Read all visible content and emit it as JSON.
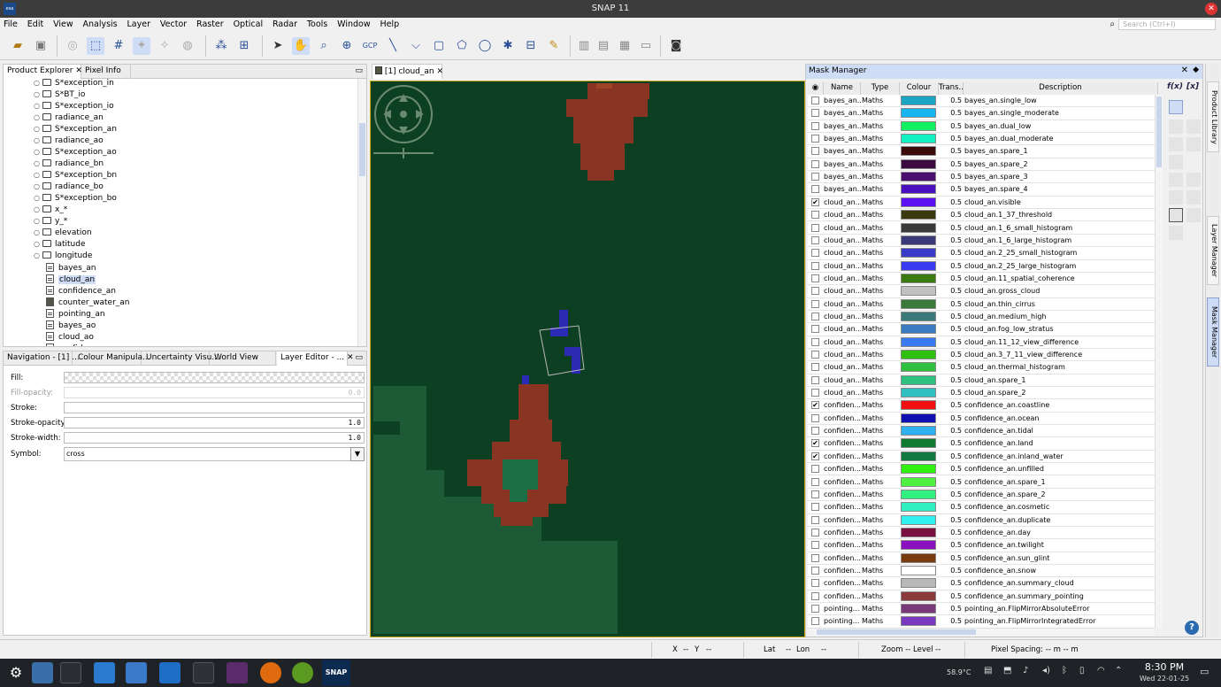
{
  "app": {
    "title": "SNAP 11",
    "logo_text": "esa SNAP"
  },
  "menu": [
    "File",
    "Edit",
    "View",
    "Analysis",
    "Layer",
    "Vector",
    "Raster",
    "Optical",
    "Radar",
    "Tools",
    "Window",
    "Help"
  ],
  "search": {
    "placeholder": "Search (Ctrl+I)"
  },
  "left_tabs": {
    "product_explorer": "Product Explorer",
    "pixel_info": "Pixel Info"
  },
  "tree": [
    {
      "label": "S*exception_in",
      "kind": "folder"
    },
    {
      "label": "S*BT_io",
      "kind": "folder"
    },
    {
      "label": "S*exception_io",
      "kind": "folder"
    },
    {
      "label": "radiance_an",
      "kind": "folder"
    },
    {
      "label": "S*exception_an",
      "kind": "folder"
    },
    {
      "label": "radiance_ao",
      "kind": "folder"
    },
    {
      "label": "S*exception_ao",
      "kind": "folder"
    },
    {
      "label": "radiance_bn",
      "kind": "folder"
    },
    {
      "label": "S*exception_bn",
      "kind": "folder"
    },
    {
      "label": "radiance_bo",
      "kind": "folder"
    },
    {
      "label": "S*exception_bo",
      "kind": "folder"
    },
    {
      "label": "x_*",
      "kind": "folder"
    },
    {
      "label": "y_*",
      "kind": "folder"
    },
    {
      "label": "elevation",
      "kind": "folder"
    },
    {
      "label": "latitude",
      "kind": "folder"
    },
    {
      "label": "longitude",
      "kind": "folder"
    },
    {
      "label": "bayes_an",
      "kind": "band"
    },
    {
      "label": "cloud_an",
      "kind": "band",
      "selected": true
    },
    {
      "label": "confidence_an",
      "kind": "band"
    },
    {
      "label": "counter_water_an",
      "kind": "band-dark"
    },
    {
      "label": "pointing_an",
      "kind": "band"
    },
    {
      "label": "bayes_ao",
      "kind": "band"
    },
    {
      "label": "cloud_ao",
      "kind": "band"
    },
    {
      "label": "confidence_ao",
      "kind": "band"
    }
  ],
  "bottom_tabs": [
    "Navigation - [1] ...",
    "Colour Manipula...",
    "Uncertainty Visu...",
    "World View",
    "Layer Editor - ..."
  ],
  "layer_editor": {
    "fill_label": "Fill:",
    "fill_opacity_label": "Fill-opacity:",
    "fill_opacity_value": "0.0",
    "stroke_label": "Stroke:",
    "stroke_opacity_label": "Stroke-opacity:",
    "stroke_opacity_value": "1.0",
    "stroke_width_label": "Stroke-width:",
    "stroke_width_value": "1.0",
    "symbol_label": "Symbol:",
    "symbol_value": "cross"
  },
  "image_tab": {
    "label": "[1] cloud_an"
  },
  "mask_manager": {
    "title": "Mask Manager",
    "columns": [
      "Name",
      "Type",
      "Colour",
      "Trans...",
      "Description"
    ],
    "fx_label": "f(x)",
    "x_label": "[x]",
    "rows": [
      {
        "name": "bayes_an...",
        "type": "Maths",
        "color": "#1aa5c4",
        "trans": "0.5",
        "desc": "bayes_an.single_low",
        "checked": false
      },
      {
        "name": "bayes_an...",
        "type": "Maths",
        "color": "#17b4f0",
        "trans": "0.5",
        "desc": "bayes_an.single_moderate",
        "checked": false
      },
      {
        "name": "bayes_an...",
        "type": "Maths",
        "color": "#10f060",
        "trans": "0.5",
        "desc": "bayes_an.dual_low",
        "checked": false
      },
      {
        "name": "bayes_an...",
        "type": "Maths",
        "color": "#10f0c0",
        "trans": "0.5",
        "desc": "bayes_an.dual_moderate",
        "checked": false
      },
      {
        "name": "bayes_an...",
        "type": "Maths",
        "color": "#3a0a0a",
        "trans": "0.5",
        "desc": "bayes_an.spare_1",
        "checked": false
      },
      {
        "name": "bayes_an...",
        "type": "Maths",
        "color": "#3a0a40",
        "trans": "0.5",
        "desc": "bayes_an.spare_2",
        "checked": false
      },
      {
        "name": "bayes_an...",
        "type": "Maths",
        "color": "#4a1070",
        "trans": "0.5",
        "desc": "bayes_an.spare_3",
        "checked": false
      },
      {
        "name": "bayes_an...",
        "type": "Maths",
        "color": "#4a10c0",
        "trans": "0.5",
        "desc": "bayes_an.spare_4",
        "checked": false
      },
      {
        "name": "cloud_an...",
        "type": "Maths",
        "color": "#5a10f0",
        "trans": "0.5",
        "desc": "cloud_an.visible",
        "checked": true
      },
      {
        "name": "cloud_an...",
        "type": "Maths",
        "color": "#3a3a10",
        "trans": "0.5",
        "desc": "cloud_an.1_37_threshold",
        "checked": false
      },
      {
        "name": "cloud_an...",
        "type": "Maths",
        "color": "#3a3a3a",
        "trans": "0.5",
        "desc": "cloud_an.1_6_small_histogram",
        "checked": false
      },
      {
        "name": "cloud_an...",
        "type": "Maths",
        "color": "#3a3a7a",
        "trans": "0.5",
        "desc": "cloud_an.1_6_large_histogram",
        "checked": false
      },
      {
        "name": "cloud_an...",
        "type": "Maths",
        "color": "#3a3ac8",
        "trans": "0.5",
        "desc": "cloud_an.2_25_small_histogram",
        "checked": false
      },
      {
        "name": "cloud_an...",
        "type": "Maths",
        "color": "#3a3af0",
        "trans": "0.5",
        "desc": "cloud_an.2_25_large_histogram",
        "checked": false
      },
      {
        "name": "cloud_an...",
        "type": "Maths",
        "color": "#3a7a10",
        "trans": "0.5",
        "desc": "cloud_an.11_spatial_coherence",
        "checked": false
      },
      {
        "name": "cloud_an...",
        "type": "Maths",
        "color": "#c0c0c0",
        "trans": "0.5",
        "desc": "cloud_an.gross_cloud",
        "checked": false
      },
      {
        "name": "cloud_an...",
        "type": "Maths",
        "color": "#3a7a3a",
        "trans": "0.5",
        "desc": "cloud_an.thin_cirrus",
        "checked": false
      },
      {
        "name": "cloud_an...",
        "type": "Maths",
        "color": "#3a7a7a",
        "trans": "0.5",
        "desc": "cloud_an.medium_high",
        "checked": false
      },
      {
        "name": "cloud_an...",
        "type": "Maths",
        "color": "#3a7ac0",
        "trans": "0.5",
        "desc": "cloud_an.fog_low_stratus",
        "checked": false
      },
      {
        "name": "cloud_an...",
        "type": "Maths",
        "color": "#3a7af0",
        "trans": "0.5",
        "desc": "cloud_an.11_12_view_difference",
        "checked": false
      },
      {
        "name": "cloud_an...",
        "type": "Maths",
        "color": "#30c010",
        "trans": "0.5",
        "desc": "cloud_an.3_7_11_view_difference",
        "checked": false
      },
      {
        "name": "cloud_an...",
        "type": "Maths",
        "color": "#30c040",
        "trans": "0.5",
        "desc": "cloud_an.thermal_histogram",
        "checked": false
      },
      {
        "name": "cloud_an...",
        "type": "Maths",
        "color": "#30c080",
        "trans": "0.5",
        "desc": "cloud_an.spare_1",
        "checked": false
      },
      {
        "name": "cloud_an...",
        "type": "Maths",
        "color": "#30c0c0",
        "trans": "0.5",
        "desc": "cloud_an.spare_2",
        "checked": false
      },
      {
        "name": "confiden...",
        "type": "Maths",
        "color": "#f01010",
        "trans": "0.5",
        "desc": "confidence_an.coastline",
        "checked": true
      },
      {
        "name": "confiden...",
        "type": "Maths",
        "color": "#1010b0",
        "trans": "0.5",
        "desc": "confidence_an.ocean",
        "checked": false
      },
      {
        "name": "confiden...",
        "type": "Maths",
        "color": "#30b0f0",
        "trans": "0.5",
        "desc": "confidence_an.tidal",
        "checked": false
      },
      {
        "name": "confiden...",
        "type": "Maths",
        "color": "#107a30",
        "trans": "0.5",
        "desc": "confidence_an.land",
        "checked": true
      },
      {
        "name": "confiden...",
        "type": "Maths",
        "color": "#107a40",
        "trans": "0.5",
        "desc": "confidence_an.inland_water",
        "checked": true
      },
      {
        "name": "confiden...",
        "type": "Maths",
        "color": "#30f010",
        "trans": "0.5",
        "desc": "confidence_an.unfilled",
        "checked": false
      },
      {
        "name": "confiden...",
        "type": "Maths",
        "color": "#50f040",
        "trans": "0.5",
        "desc": "confidence_an.spare_1",
        "checked": false
      },
      {
        "name": "confiden...",
        "type": "Maths",
        "color": "#30f080",
        "trans": "0.5",
        "desc": "confidence_an.spare_2",
        "checked": false
      },
      {
        "name": "confiden...",
        "type": "Maths",
        "color": "#30f0c0",
        "trans": "0.5",
        "desc": "confidence_an.cosmetic",
        "checked": false
      },
      {
        "name": "confiden...",
        "type": "Maths",
        "color": "#30f0f0",
        "trans": "0.5",
        "desc": "confidence_an.duplicate",
        "checked": false
      },
      {
        "name": "confiden...",
        "type": "Maths",
        "color": "#7a1040",
        "trans": "0.5",
        "desc": "confidence_an.day",
        "checked": false
      },
      {
        "name": "confiden...",
        "type": "Maths",
        "color": "#8a10c0",
        "trans": "0.5",
        "desc": "confidence_an.twilight",
        "checked": false
      },
      {
        "name": "confiden...",
        "type": "Maths",
        "color": "#7a3a10",
        "trans": "0.5",
        "desc": "confidence_an.sun_glint",
        "checked": false
      },
      {
        "name": "confiden...",
        "type": "Maths",
        "color": "#ffffff",
        "trans": "0.5",
        "desc": "confidence_an.snow",
        "checked": false
      },
      {
        "name": "confiden...",
        "type": "Maths",
        "color": "#b8b8b8",
        "trans": "0.5",
        "desc": "confidence_an.summary_cloud",
        "checked": false
      },
      {
        "name": "confiden...",
        "type": "Maths",
        "color": "#8a3a3a",
        "trans": "0.5",
        "desc": "confidence_an.summary_pointing",
        "checked": false
      },
      {
        "name": "pointing...",
        "type": "Maths",
        "color": "#7a3a7a",
        "trans": "0.5",
        "desc": "pointing_an.FlipMirrorAbsoluteError",
        "checked": false
      },
      {
        "name": "pointing...",
        "type": "Maths",
        "color": "#7a3ac0",
        "trans": "0.5",
        "desc": "pointing_an.FlipMirrorIntegratedError",
        "checked": false
      }
    ]
  },
  "right_side_tabs": [
    "Product Library",
    "Layer Manager",
    "Mask Manager"
  ],
  "status": {
    "x": "X",
    "x_val": "--",
    "y": "Y",
    "y_val": "--",
    "lat": "Lat",
    "lat_val": "--",
    "lon": "Lon",
    "lon_val": "--",
    "zoom": "Zoom --",
    "level": "Level --",
    "pixel_spacing": "Pixel Spacing: -- m -- m"
  },
  "taskbar": {
    "temp": "58.9°C",
    "time": "8:30 PM",
    "date": "Wed 22-01-25",
    "snap_label": "SNAP"
  }
}
